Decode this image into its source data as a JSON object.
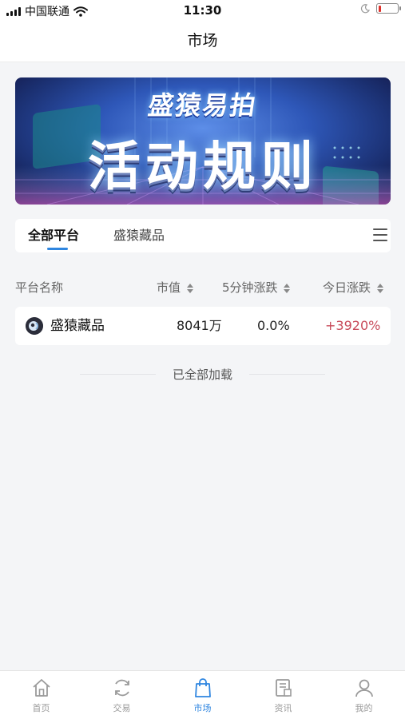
{
  "status_bar": {
    "carrier": "中国联通",
    "time": "11:30",
    "battery_level": 0.15,
    "battery_color": "#e0302a"
  },
  "nav": {
    "title": "市场"
  },
  "banner": {
    "subtitle": "盛猿易拍",
    "title": "活动规则"
  },
  "tabs": [
    {
      "label": "全部平台",
      "active": true
    },
    {
      "label": "盛猿藏品",
      "active": false
    }
  ],
  "table": {
    "headers": {
      "name": "平台名称",
      "market_cap": "市值",
      "change_5m": "5分钟涨跌",
      "change_today": "今日涨跌"
    },
    "rows": [
      {
        "logo_icon": "shengyuan-logo-icon",
        "name": "盛猿藏品",
        "market_cap": "8041万",
        "change_5m": "0.0%",
        "change_today": "+3920%"
      }
    ]
  },
  "loaded_text": "已全部加载",
  "accent_color": "#2f86e0",
  "tabbar": [
    {
      "label": "首页",
      "icon": "home-icon",
      "active": false
    },
    {
      "label": "交易",
      "icon": "refresh-icon",
      "active": false
    },
    {
      "label": "市场",
      "icon": "shopping-bag-icon",
      "active": true
    },
    {
      "label": "资讯",
      "icon": "news-icon",
      "active": false
    },
    {
      "label": "我的",
      "icon": "user-icon",
      "active": false
    }
  ]
}
